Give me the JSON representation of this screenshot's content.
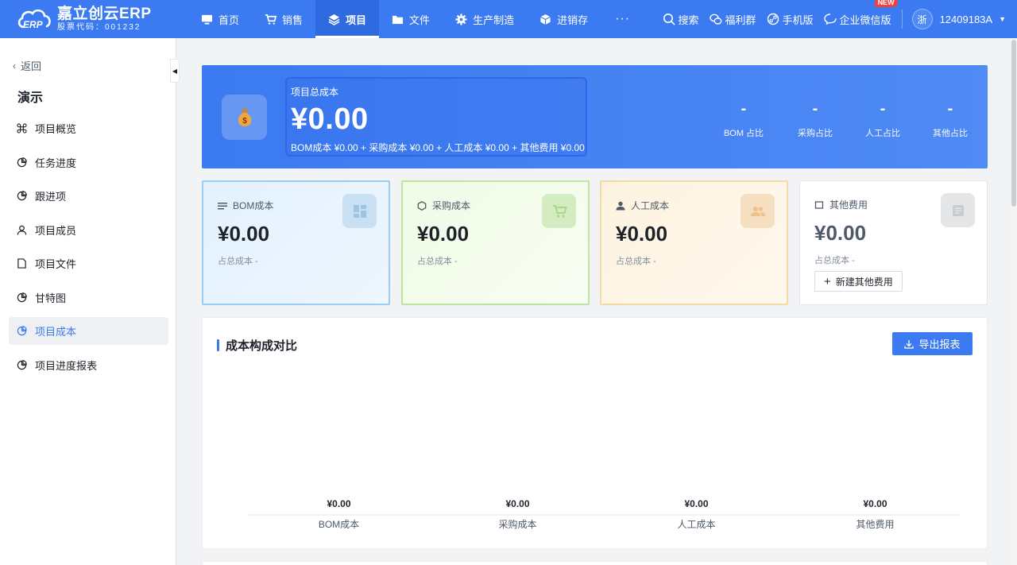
{
  "brand": {
    "name": "嘉立创云ERP",
    "stock_code": "股票代码：001232",
    "mark_text": "ERP"
  },
  "nav": [
    {
      "label": "首页",
      "icon": "monitor-icon"
    },
    {
      "label": "销售",
      "icon": "cart-icon"
    },
    {
      "label": "项目",
      "icon": "layers-icon",
      "active": true
    },
    {
      "label": "文件",
      "icon": "folder-icon"
    },
    {
      "label": "生产制造",
      "icon": "cog-icon"
    },
    {
      "label": "进销存",
      "icon": "box-icon"
    }
  ],
  "nav_more": "···",
  "header_right": {
    "search": "搜索",
    "welfare": "福利群",
    "mobile": "手机版",
    "wecom": "企业微信版",
    "new_badge": "NEW",
    "avatar": "浙",
    "username": "12409183A"
  },
  "sidebar": {
    "back": "返回",
    "project_name": "演示",
    "items": [
      {
        "label": "项目概览",
        "icon": "command-icon"
      },
      {
        "label": "任务进度",
        "icon": "pie-icon"
      },
      {
        "label": "跟进项",
        "icon": "pie-icon"
      },
      {
        "label": "项目成员",
        "icon": "user-icon"
      },
      {
        "label": "项目文件",
        "icon": "file-icon"
      },
      {
        "label": "甘特图",
        "icon": "pie-icon"
      },
      {
        "label": "项目成本",
        "icon": "pie-icon",
        "active": true
      },
      {
        "label": "项目进度报表",
        "icon": "pie-icon"
      }
    ]
  },
  "summary": {
    "total_label": "项目总成本",
    "total_value": "¥0.00",
    "formula": "BOM成本 ¥0.00 + 采购成本 ¥0.00 + 人工成本 ¥0.00 + 其他费用 ¥0.00",
    "ratios": [
      {
        "value": "-",
        "label": "BOM 占比"
      },
      {
        "value": "-",
        "label": "采购占比"
      },
      {
        "value": "-",
        "label": "人工占比"
      },
      {
        "value": "-",
        "label": "其他占比"
      }
    ]
  },
  "cards": {
    "bom": {
      "title": "BOM成本",
      "value": "¥0.00",
      "ratio": "占总成本 -"
    },
    "purchase": {
      "title": "采购成本",
      "value": "¥0.00",
      "ratio": "占总成本 -"
    },
    "labor": {
      "title": "人工成本",
      "value": "¥0.00",
      "ratio": "占总成本 -"
    },
    "other": {
      "title": "其他费用",
      "value": "¥0.00",
      "ratio": "占总成本 -",
      "add_button": "新建其他费用"
    }
  },
  "chart_panel": {
    "title": "成本构成对比",
    "export_button": "导出报表"
  },
  "colors": {
    "primary": "#3b7af0",
    "bom_border": "#98cdf4",
    "purchase_border": "#bfe3a1",
    "labor_border": "#f3dba8"
  },
  "chart_data": {
    "type": "bar",
    "categories": [
      "BOM成本",
      "采购成本",
      "人工成本",
      "其他费用"
    ],
    "values": [
      0,
      0,
      0,
      0
    ],
    "data_labels": [
      "¥0.00",
      "¥0.00",
      "¥0.00",
      "¥0.00"
    ],
    "title": "成本构成对比",
    "xlabel": "",
    "ylabel": "",
    "grid": false,
    "legend": "none"
  }
}
